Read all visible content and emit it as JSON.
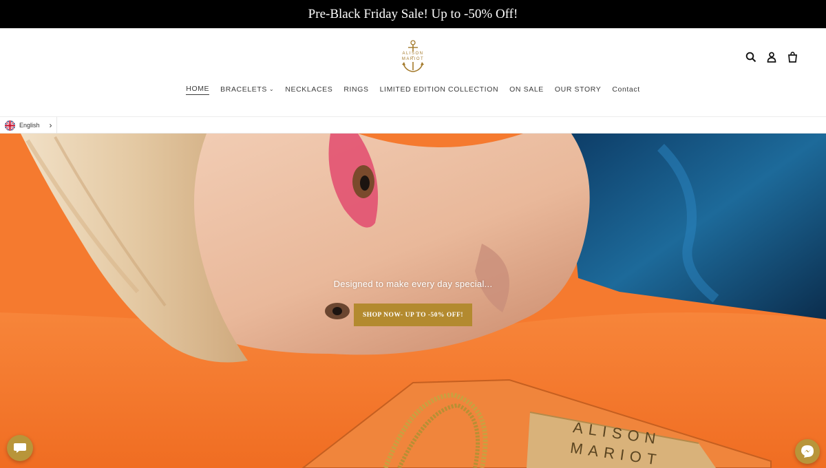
{
  "announcement": {
    "text": "Pre-Black Friday Sale! Up to -50% Off!"
  },
  "brand": {
    "line1": "ALISON",
    "line2": "MARIOT",
    "color": "#b38a2f"
  },
  "header_icons": [
    "search-icon",
    "account-icon",
    "cart-icon"
  ],
  "nav": {
    "items": [
      {
        "label": "HOME",
        "active": true
      },
      {
        "label": "BRACELETS",
        "has_dropdown": true
      },
      {
        "label": "NECKLACES"
      },
      {
        "label": "RINGS"
      },
      {
        "label": "LIMITED EDITION COLLECTION"
      },
      {
        "label": "ON SALE"
      },
      {
        "label": "OUR STORY"
      },
      {
        "label": "Contact"
      }
    ]
  },
  "language": {
    "label": "English",
    "flag": "uk-flag-icon"
  },
  "hero": {
    "tagline": "Designed to make every day special...",
    "cta": "SHOP NOW- UP TO -50% OFF!",
    "plaque_line1": "ALISON",
    "plaque_line2": "MARIOT",
    "background_color": "#f57a2f"
  },
  "widgets": {
    "chat": "chat-icon",
    "messenger": "messenger-icon"
  }
}
